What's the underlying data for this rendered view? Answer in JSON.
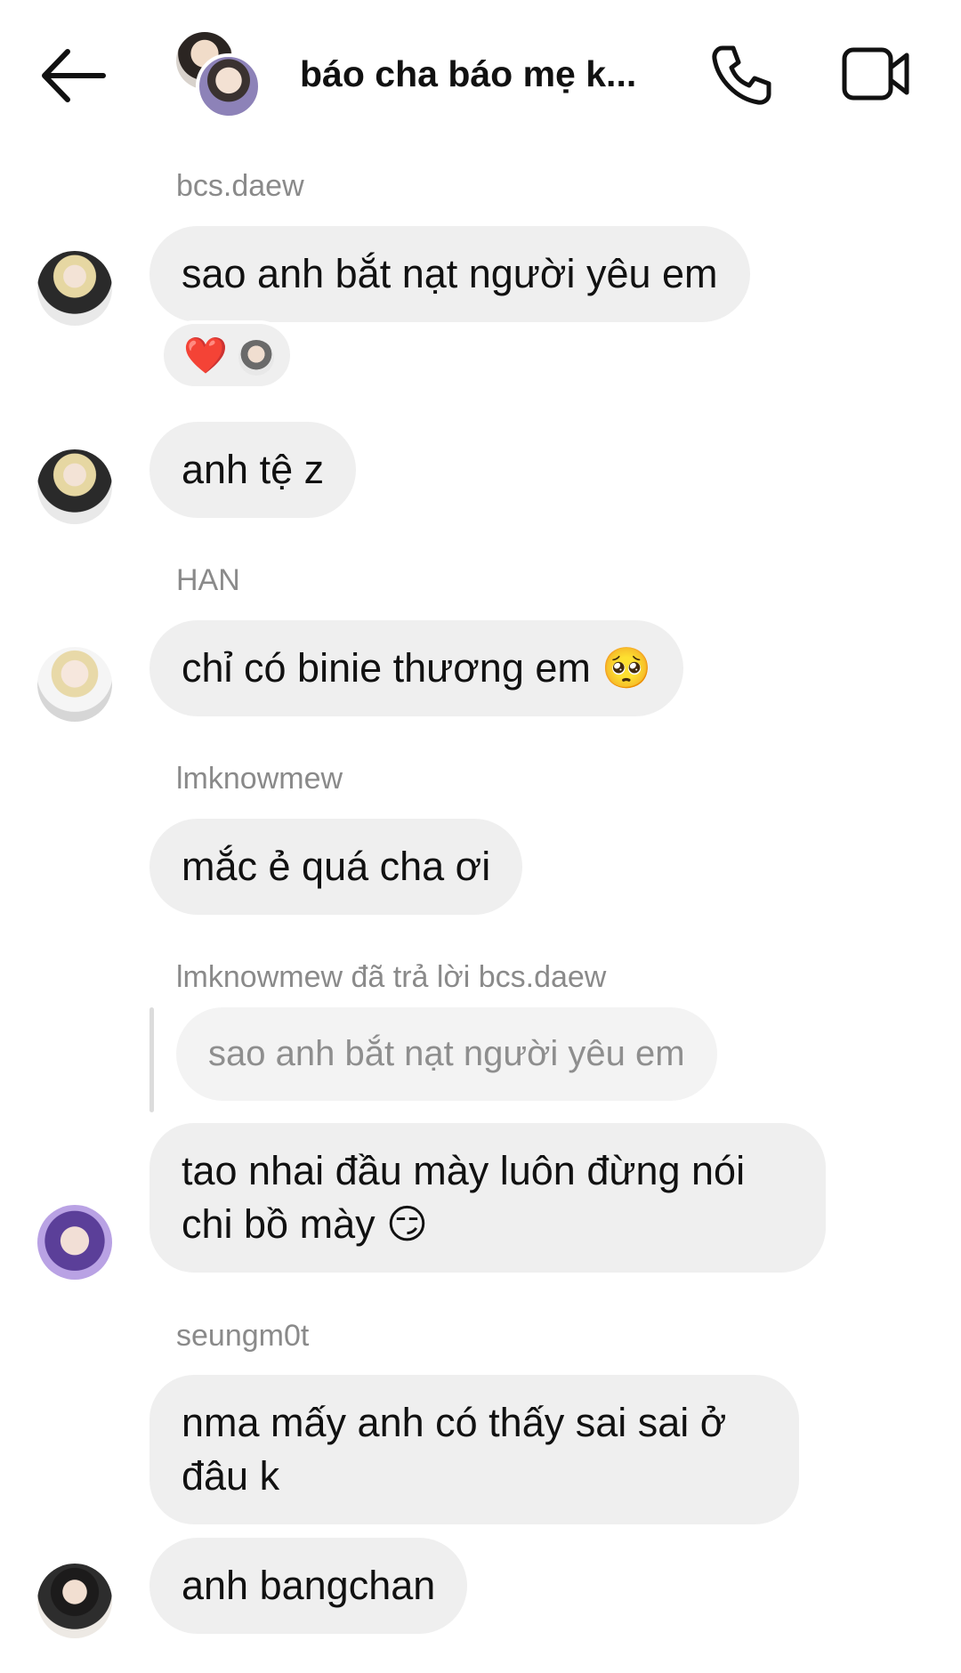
{
  "header": {
    "title": "báo cha báo mẹ k...",
    "back_icon": "arrow-left-icon",
    "call_icon": "phone-icon",
    "video_icon": "video-camera-icon"
  },
  "messages": [
    {
      "sender": "bcs.daew",
      "text": "sao anh bắt nạt người yêu em"
    },
    {
      "text": "anh tệ z"
    },
    {
      "sender": "HAN",
      "text": "chỉ có binie thương em 🥺"
    },
    {
      "sender": "lmknowmew",
      "text": "mắc ẻ quá cha ơi"
    },
    {
      "sender": "lmknowmew đã trả lời bcs.daew",
      "reply_quote": "sao anh bắt nạt người yêu em",
      "text": "tao nhai đầu mày luôn đừng nói chi bồ mày 😏"
    },
    {
      "sender": "seungm0t",
      "text": "nma mấy anh có thấy sai sai ở đâu k"
    },
    {
      "text": "anh bangchan"
    }
  ],
  "reaction": {
    "emoji": "❤️"
  }
}
